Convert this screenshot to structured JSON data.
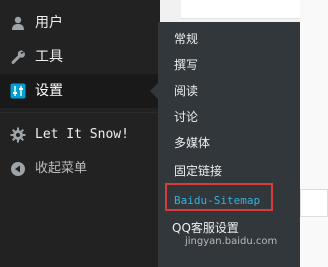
{
  "sidebar": {
    "items": [
      {
        "label": "用户",
        "icon": "user-icon"
      },
      {
        "label": "工具",
        "icon": "wrench-icon"
      },
      {
        "label": "设置",
        "icon": "settings-sliders-icon",
        "current": true
      },
      {
        "label": "Let It Snow!",
        "icon": "gear-icon"
      },
      {
        "label": "收起菜单",
        "icon": "collapse-arrow-icon"
      }
    ]
  },
  "settings_submenu": {
    "items": [
      {
        "label": "常规"
      },
      {
        "label": "撰写"
      },
      {
        "label": "阅读"
      },
      {
        "label": "讨论"
      },
      {
        "label": "多媒体"
      },
      {
        "label": "固定链接"
      },
      {
        "label": "Baidu-Sitemap",
        "highlighted": true
      },
      {
        "label": "QQ客服设置"
      }
    ]
  },
  "watermark": {
    "text": "jingyan.baidu.com"
  },
  "colors": {
    "menu_bg": "#222222",
    "submenu_bg": "#32373c",
    "active_link": "#33b3db",
    "highlight_border": "#d93b3b"
  }
}
